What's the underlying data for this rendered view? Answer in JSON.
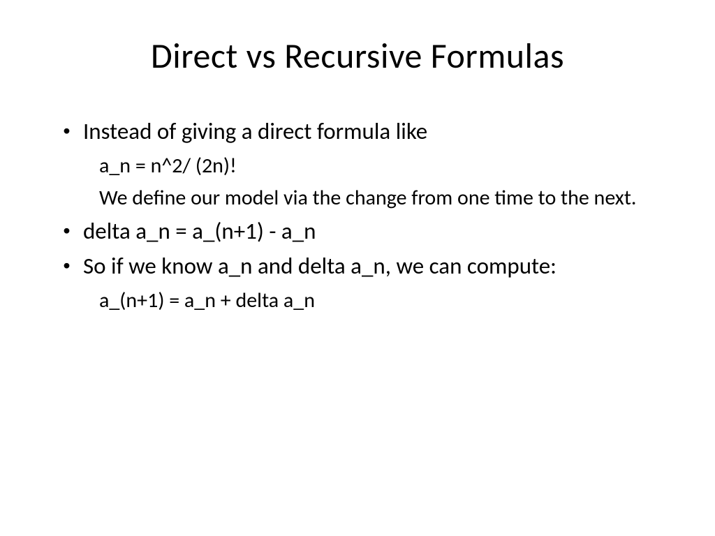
{
  "slide": {
    "title": "Direct vs Recursive Formulas",
    "bullets": [
      {
        "text": "Instead of giving a direct formula like",
        "subs": [
          "a_n = n^2/ (2n)!",
          "We define our model via the change from one time to the next."
        ]
      },
      {
        "text": "delta a_n = a_(n+1)  -  a_n",
        "subs": []
      },
      {
        "text": "So if we know a_n and delta a_n, we can compute:",
        "subs": [
          "a_(n+1) = a_n + delta a_n"
        ]
      }
    ]
  }
}
